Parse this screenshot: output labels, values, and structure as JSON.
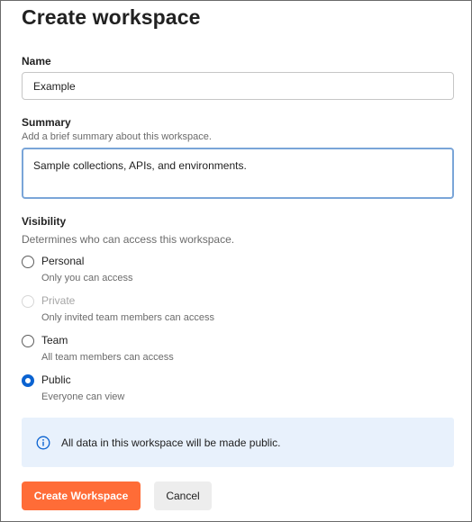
{
  "dialog": {
    "title": "Create workspace"
  },
  "name_field": {
    "label": "Name",
    "value": "Example"
  },
  "summary_field": {
    "label": "Summary",
    "hint": "Add a brief summary about this workspace.",
    "value": "Sample collections, APIs, and environments."
  },
  "visibility": {
    "label": "Visibility",
    "hint": "Determines who can access this workspace.",
    "selected": "Public",
    "options": [
      {
        "label": "Personal",
        "description": "Only you can access",
        "disabled": false
      },
      {
        "label": "Private",
        "description": "Only invited team members can access",
        "disabled": true
      },
      {
        "label": "Team",
        "description": "All team members can access",
        "disabled": false
      },
      {
        "label": "Public",
        "description": "Everyone can view",
        "disabled": false
      }
    ]
  },
  "banner": {
    "icon": "info-icon",
    "text": "All data in this workspace will be made public."
  },
  "actions": {
    "create_label": "Create Workspace",
    "cancel_label": "Cancel"
  },
  "colors": {
    "primary": "#ff6c37",
    "radio_selected": "#0b63d1",
    "banner_bg": "#e8f1fc",
    "focus_border": "#7aa5d8"
  }
}
